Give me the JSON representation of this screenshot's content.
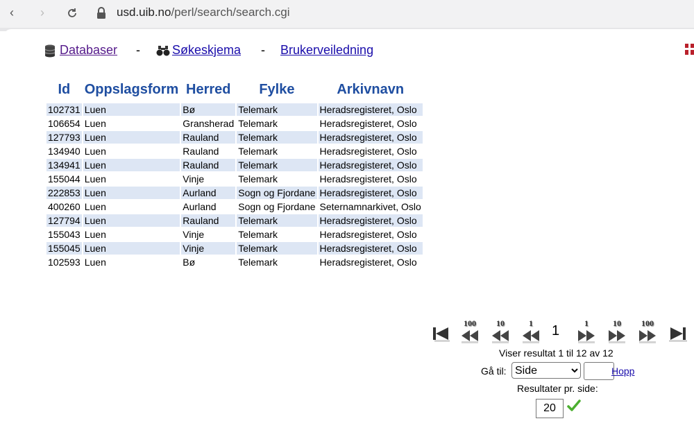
{
  "browser": {
    "url_host": "usd.uib.no",
    "url_path": "/perl/search/search.cgi"
  },
  "nav": {
    "databaser": "Databaser",
    "dash1": "-",
    "sokeskjema": "Søkeskjema",
    "dash2": "-",
    "brukerveiledning": "Brukerveiledning"
  },
  "table": {
    "headers": [
      "Id",
      "Oppslagsform",
      "Herred",
      "Fylke",
      "Arkivnavn"
    ],
    "rows": [
      [
        "102731",
        "Luen",
        "Bø",
        "Telemark",
        "Heradsregisteret, Oslo"
      ],
      [
        "106654",
        "Luen",
        "Gransherad",
        "Telemark",
        "Heradsregisteret, Oslo"
      ],
      [
        "127793",
        "Luen",
        "Rauland",
        "Telemark",
        "Heradsregisteret, Oslo"
      ],
      [
        "134940",
        "Luen",
        "Rauland",
        "Telemark",
        "Heradsregisteret, Oslo"
      ],
      [
        "134941",
        "Luen",
        "Rauland",
        "Telemark",
        "Heradsregisteret, Oslo"
      ],
      [
        "155044",
        "Luen",
        "Vinje",
        "Telemark",
        "Heradsregisteret, Oslo"
      ],
      [
        "222853",
        "Luen",
        "Aurland",
        "Sogn og Fjordane",
        "Heradsregisteret, Oslo"
      ],
      [
        "400260",
        "Luen",
        "Aurland",
        "Sogn og Fjordane",
        "Seternamnarkivet, Oslo"
      ],
      [
        "127794",
        "Luen",
        "Rauland",
        "Telemark",
        "Heradsregisteret, Oslo"
      ],
      [
        "155043",
        "Luen",
        "Vinje",
        "Telemark",
        "Heradsregisteret, Oslo"
      ],
      [
        "155045",
        "Luen",
        "Vinje",
        "Telemark",
        "Heradsregisteret, Oslo"
      ],
      [
        "102593",
        "Luen",
        "Bø",
        "Telemark",
        "Heradsregisteret, Oslo"
      ]
    ]
  },
  "pager": {
    "back100": "100",
    "back10": "10",
    "back1": "1",
    "current": "1",
    "fwd1": "1",
    "fwd10": "10",
    "fwd100": "100",
    "showing": "Viser resultat 1 til 12 av 12",
    "goto_label": "Gå til:",
    "goto_selected": "Side",
    "hopp": "Hopp",
    "perpage_label": "Resultater pr. side:",
    "perpage_value": "20"
  }
}
